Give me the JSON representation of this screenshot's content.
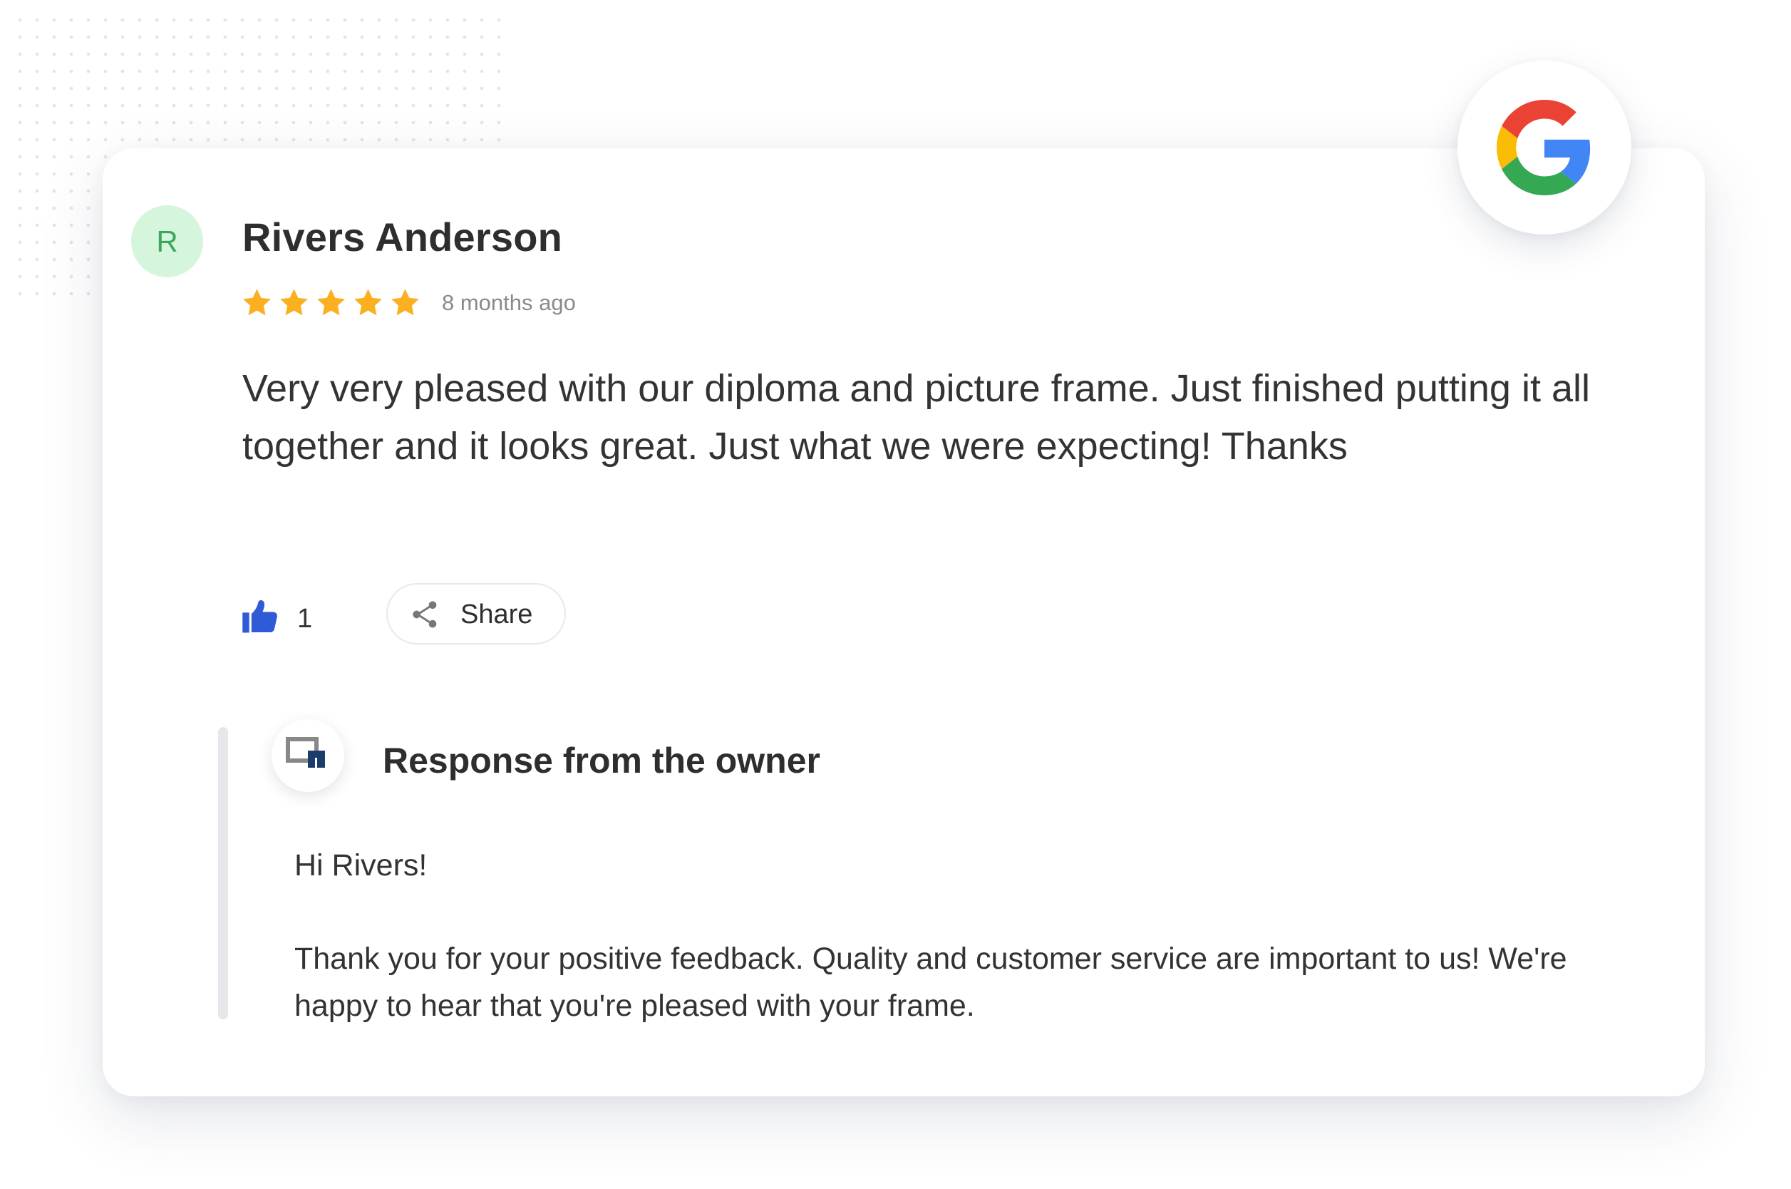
{
  "review": {
    "avatar_initial": "R",
    "reviewer_name": "Rivers Anderson",
    "rating": 5,
    "rating_max": 5,
    "time_ago": "8 months ago",
    "text": "Very very pleased with our diploma and picture frame. Just finished putting it all together and it looks great. Just what we were expecting! Thanks",
    "like_count": "1",
    "share_label": "Share"
  },
  "response": {
    "title": "Response from the owner",
    "greeting": "Hi Rivers!",
    "text": "Thank you for your positive feedback. Quality and customer service are important to us! We're happy to hear that you're pleased with your frame."
  },
  "icons": {
    "platform": "google-g-icon",
    "star": "star-icon",
    "like": "thumbs-up-icon",
    "share": "share-icon",
    "owner_logo": "frame-logo-icon"
  },
  "colors": {
    "star": "#fbb01f",
    "like": "#2f5bd6",
    "avatar_bg": "#d6f5dd",
    "avatar_text": "#3ea65c",
    "google_red": "#ea4335",
    "google_yellow": "#fbbc05",
    "google_green": "#34a853",
    "google_blue": "#4285f4",
    "owner_logo_navy": "#1c3d6b"
  }
}
